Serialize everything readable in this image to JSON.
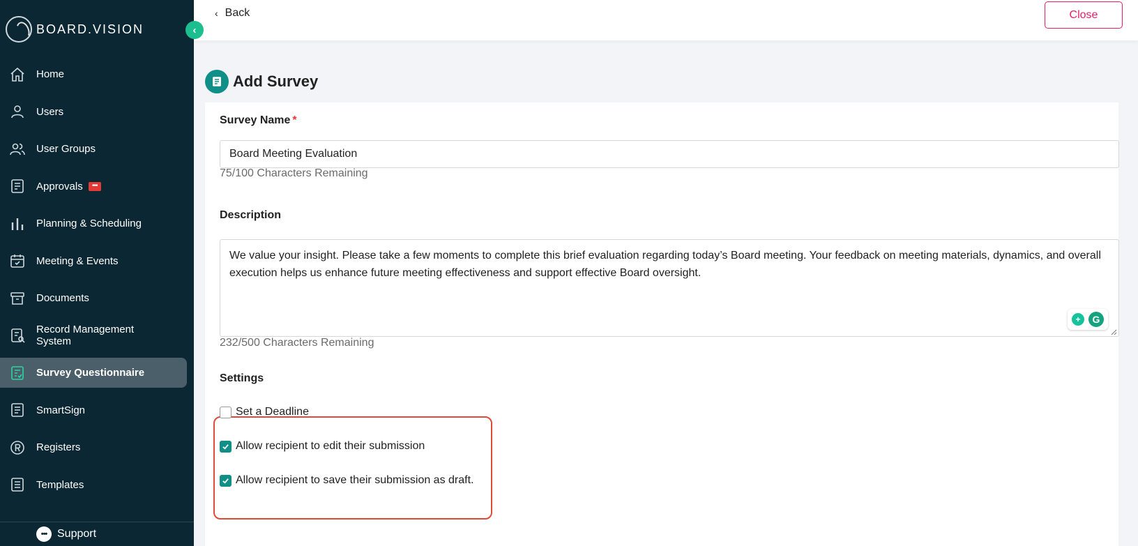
{
  "app": {
    "brand": "BOARD.VISION"
  },
  "sidebar": {
    "items": [
      {
        "label": "Home",
        "icon": "home-icon"
      },
      {
        "label": "Users",
        "icon": "user-icon"
      },
      {
        "label": "User Groups",
        "icon": "user-group-icon"
      },
      {
        "label": "Approvals",
        "icon": "approvals-icon",
        "badge": "•••"
      },
      {
        "label": "Planning & Scheduling",
        "icon": "bar-chart-icon"
      },
      {
        "label": "Meeting & Events",
        "icon": "calendar-icon"
      },
      {
        "label": "Documents",
        "icon": "archive-box-icon"
      },
      {
        "label": "Record Management System",
        "icon": "record-search-icon"
      },
      {
        "label": "Survey Questionnaire",
        "icon": "survey-icon",
        "active": true
      },
      {
        "label": "SmartSign",
        "icon": "document-sign-icon"
      },
      {
        "label": "Registers",
        "icon": "registered-icon"
      },
      {
        "label": "Templates",
        "icon": "template-icon"
      }
    ],
    "support_label": "Support"
  },
  "header": {
    "back_label": "Back",
    "close_label": "Close"
  },
  "page": {
    "title": "Add Survey"
  },
  "form": {
    "survey_name": {
      "label": "Survey Name",
      "required_mark": "*",
      "value": "Board Meeting Evaluation",
      "helper": "75/100 Characters Remaining"
    },
    "description": {
      "label": "Description",
      "value": "We value your insight. Please take a few moments to complete this brief evaluation regarding today’s Board meeting. Your feedback on meeting materials, dynamics, and overall execution helps us enhance future meeting effectiveness and support effective Board oversight.",
      "helper": "232/500 Characters Remaining"
    },
    "settings": {
      "label": "Settings",
      "options": [
        {
          "label": "Set a Deadline",
          "checked": false
        },
        {
          "label": "Allow recipient to edit their submission",
          "checked": true
        },
        {
          "label": "Allow recipient to save their submission as draft.",
          "checked": true
        }
      ]
    }
  },
  "colors": {
    "sidebar_bg": "#0b2733",
    "accent": "#0f8f87",
    "close": "#e91e63",
    "highlight_border": "#e04a3a"
  }
}
